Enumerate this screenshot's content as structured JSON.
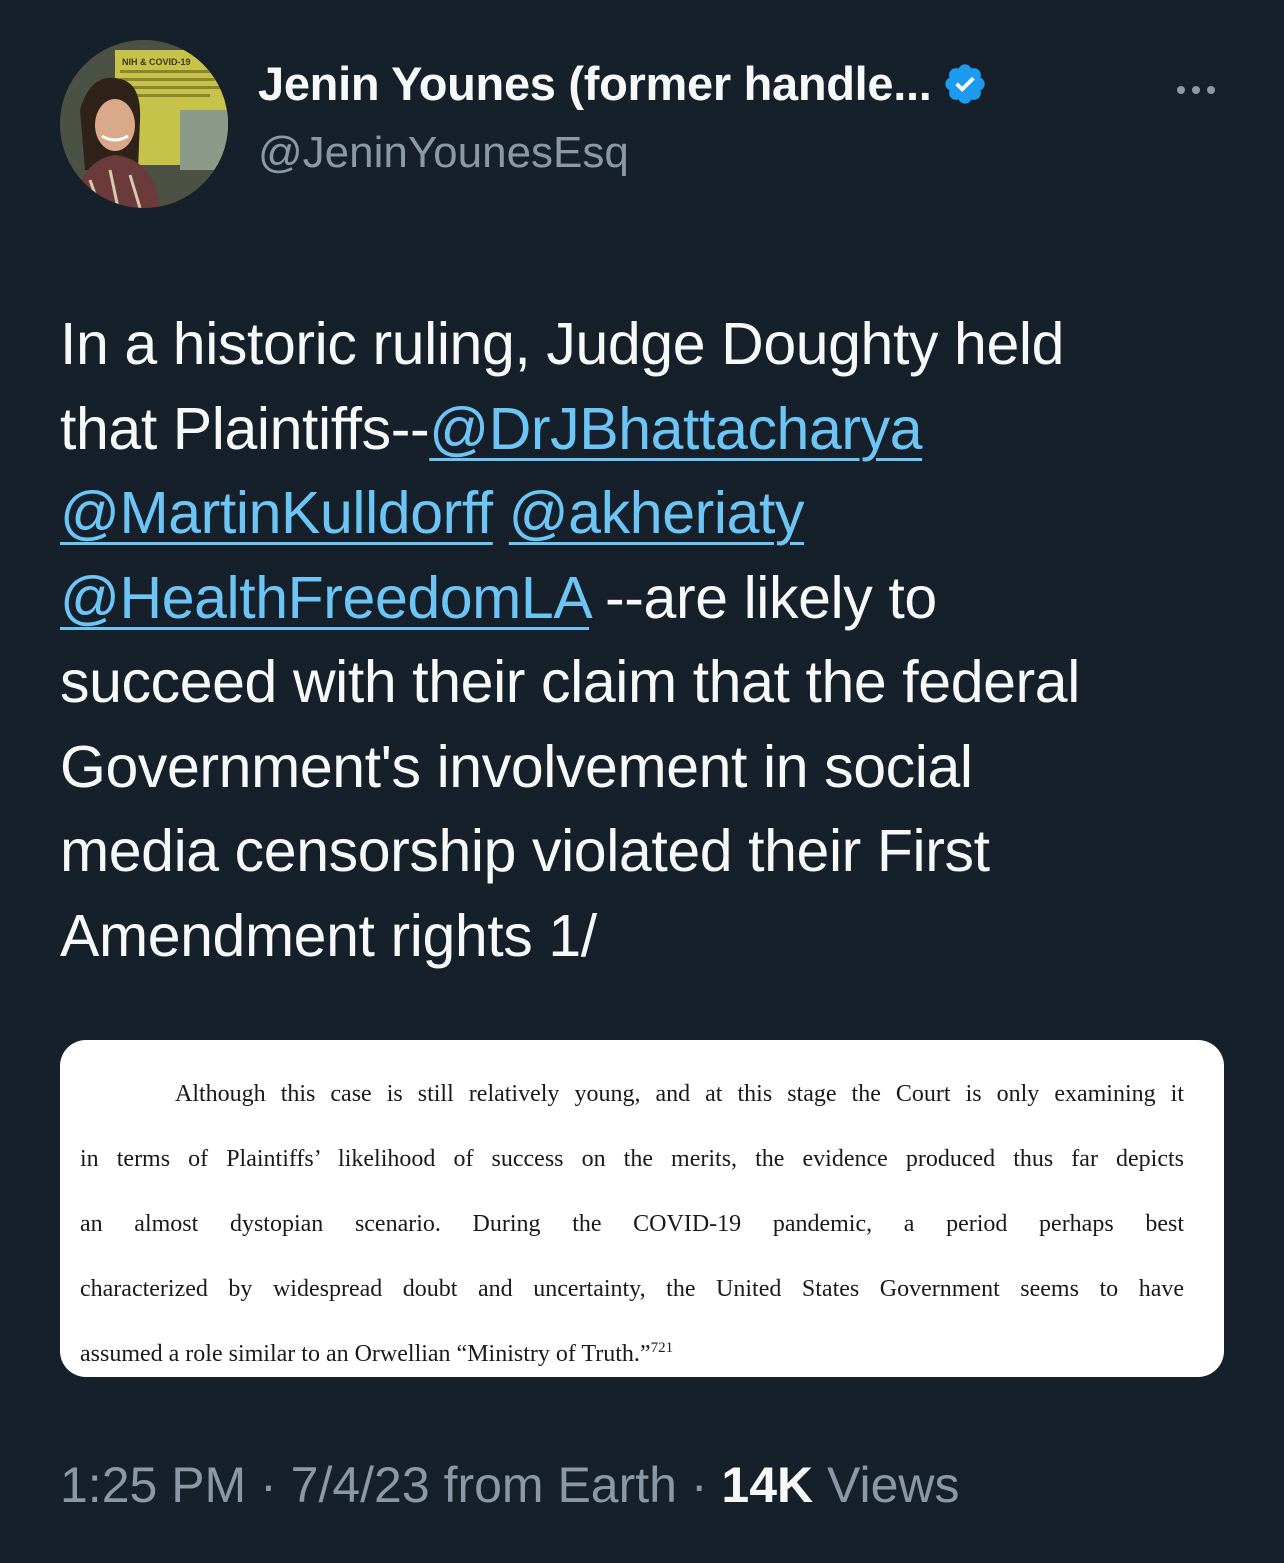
{
  "author": {
    "display_name": "Jenin Younes (former handle...",
    "handle": "@JeninYounesEsq",
    "verified": true,
    "avatar_poster_text": "NIH & COVID-19"
  },
  "tweet": {
    "line1": "In a historic ruling, Judge Doughty held",
    "line2_prefix": "that Plaintiffs--",
    "mention1": "@DrJBhattacharya",
    "mention2": "@MartinKulldorff",
    "mention3": "@akheriaty",
    "mention4": "@HealthFreedomLA",
    "line4_suffix": " --are likely to",
    "line5": "succeed with their claim that the federal",
    "line6": "Government's involvement in social",
    "line7": "media censorship violated their First",
    "line8": "Amendment rights 1/"
  },
  "media": {
    "line1": "Although this case is still relatively young, and at this stage the Court is only examining it",
    "line2": "in terms of Plaintiffs’ likelihood of success on the merits, the evidence produced thus far depicts",
    "line3": "an almost dystopian scenario. During the COVID-19 pandemic, a period perhaps best",
    "line4": "characterized by widespread doubt and uncertainty, the United States Government seems to have",
    "line5": "assumed a role similar to an Orwellian “Ministry of Truth.”",
    "footnote": "721"
  },
  "meta": {
    "time": "1:25 PM",
    "sep1": " · ",
    "date": "7/4/23",
    "source": " from Earth",
    "sep2": " · ",
    "views_count": "14K",
    "views_label": " Views"
  },
  "colors": {
    "background": "#15202b",
    "text_primary": "#f7f9f9",
    "text_secondary": "#8b98a5",
    "link": "#6cc5f5",
    "verified_badge": "#1d9bf0"
  },
  "icons": {
    "verified": "verified-badge-icon",
    "more": "more-dots-icon"
  }
}
